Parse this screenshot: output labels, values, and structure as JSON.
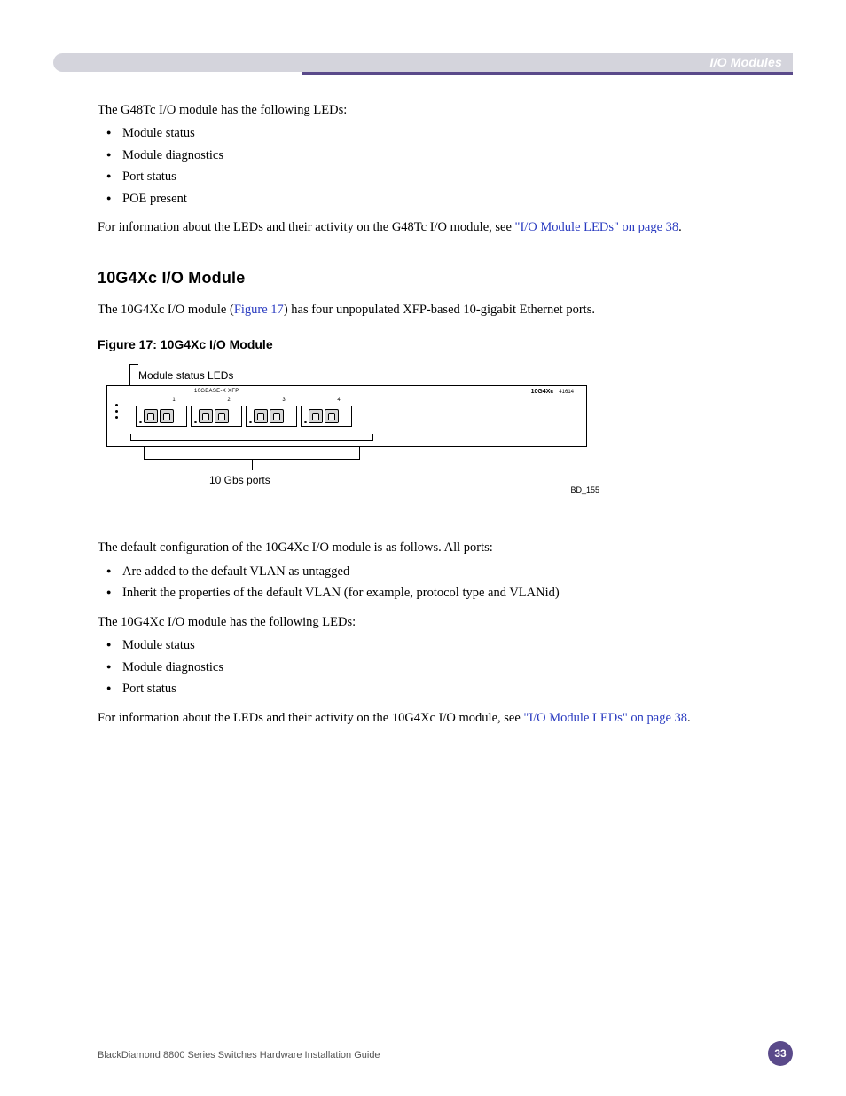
{
  "header": {
    "section": "I/O Modules"
  },
  "para1": "The G48Tc I/O module has the following LEDs:",
  "list1": [
    "Module status",
    "Module diagnostics",
    "Port status",
    "POE present"
  ],
  "para2a": "For information about the LEDs and their activity on the G48Tc I/O module, see ",
  "link1": "\"I/O Module LEDs\" on page 38",
  "heading2": "10G4Xc I/O Module",
  "para3a": "The 10G4Xc I/O module (",
  "figref": "Figure 17",
  "para3b": ") has four unpopulated XFP-based 10-gigabit Ethernet ports.",
  "figcap": "Figure 17:  10G4Xc I/O Module",
  "fig": {
    "topLabel": "Module status LEDs",
    "bottomLabel": "10 Gbs ports",
    "id": "BD_155",
    "board": {
      "typeLabel": "10GBASE-X XFP",
      "model": "10G4Xc",
      "partno": "41614"
    }
  },
  "para4": "The default configuration of the 10G4Xc I/O module is as follows. All ports:",
  "list2": [
    "Are added to the default VLAN as untagged",
    "Inherit the properties of the default VLAN (for example, protocol type and VLANid)"
  ],
  "para5": "The 10G4Xc I/O module has the following LEDs:",
  "list3": [
    "Module status",
    "Module diagnostics",
    "Port status"
  ],
  "para6a": "For information about the LEDs and their activity on the 10G4Xc I/O module, see ",
  "link2": "\"I/O Module LEDs\" on page 38",
  "footer": {
    "title": "BlackDiamond 8800 Series Switches Hardware Installation Guide",
    "page": "33"
  }
}
